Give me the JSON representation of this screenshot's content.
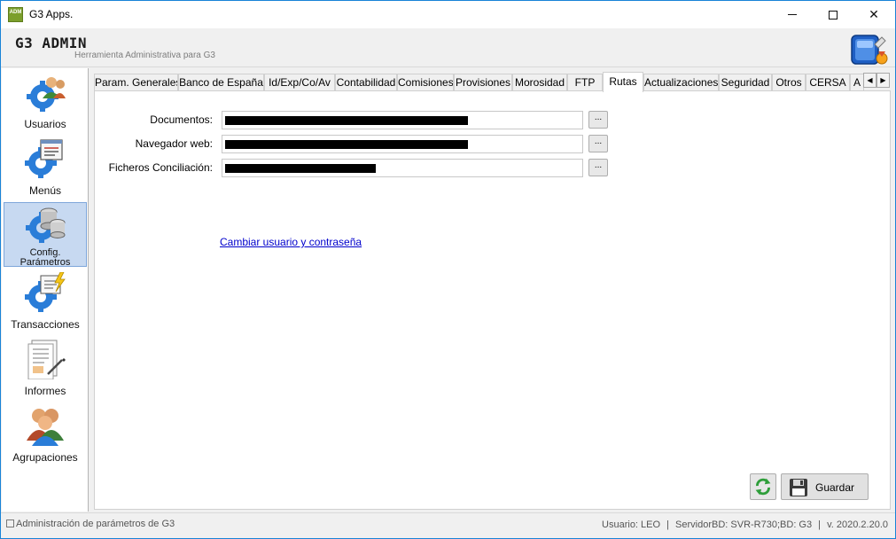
{
  "window": {
    "title": "G3 Apps.",
    "icon_text": "ADM",
    "minimize_icon": "minimize-icon",
    "maximize_icon": "maximize-icon",
    "close_symbol": "✕"
  },
  "header": {
    "app_name": "G3 ADMIN",
    "subtitle": "Herramienta Administrativa para G3",
    "logo_icon": "g3-admin-logo-icon"
  },
  "sidebar": {
    "items": [
      {
        "label": "Usuarios",
        "icon": "users-gear-icon",
        "active": false
      },
      {
        "label": "Menús",
        "icon": "menu-window-gear-icon",
        "active": false
      },
      {
        "label": "Config. Parámetros",
        "icon": "database-gear-icon",
        "active": true
      },
      {
        "label": "Transacciones",
        "icon": "transaction-gear-icon",
        "active": false
      },
      {
        "label": "Informes",
        "icon": "report-document-icon",
        "active": false
      },
      {
        "label": "Agrupaciones",
        "icon": "user-group-icon",
        "active": false
      }
    ]
  },
  "tabs": [
    {
      "label": "Param. Generales",
      "active": false
    },
    {
      "label": "Banco de España",
      "active": false
    },
    {
      "label": "Id/Exp/Co/Av",
      "active": false
    },
    {
      "label": "Contabilidad",
      "active": false
    },
    {
      "label": "Comisiones",
      "active": false
    },
    {
      "label": "Provisiones",
      "active": false
    },
    {
      "label": "Morosidad",
      "active": false
    },
    {
      "label": "FTP",
      "active": false
    },
    {
      "label": "Rutas",
      "active": true
    },
    {
      "label": "Actualizaciones",
      "active": false
    },
    {
      "label": "Seguridad",
      "active": false
    },
    {
      "label": "Otros",
      "active": false
    },
    {
      "label": "CERSA",
      "active": false
    },
    {
      "label": "A",
      "active": false
    }
  ],
  "tab_scroll": {
    "left": "◀",
    "right": "▶"
  },
  "form": {
    "fields": [
      {
        "label": "Documentos:",
        "value": "",
        "browse_label": "..."
      },
      {
        "label": "Navegador web:",
        "value": "",
        "browse_label": "..."
      },
      {
        "label": "Ficheros Conciliación:",
        "value": "",
        "browse_label": "..."
      }
    ],
    "change_user_link": "Cambiar usuario y contraseña"
  },
  "actions": {
    "refresh_icon": "refresh-arrows-icon",
    "save_label": "Guardar",
    "save_icon": "floppy-disk-icon"
  },
  "statusbar": {
    "left_text": "Administración de parámetros de G3",
    "user": "Usuario: LEO",
    "server": "ServidorBD: SVR-R730;BD: G3",
    "version": "v. 2020.2.20.0",
    "separator": "|"
  },
  "colors": {
    "accent_border": "#1883d7",
    "active_nav_bg": "#c7d9f1",
    "link": "#0000cc"
  }
}
